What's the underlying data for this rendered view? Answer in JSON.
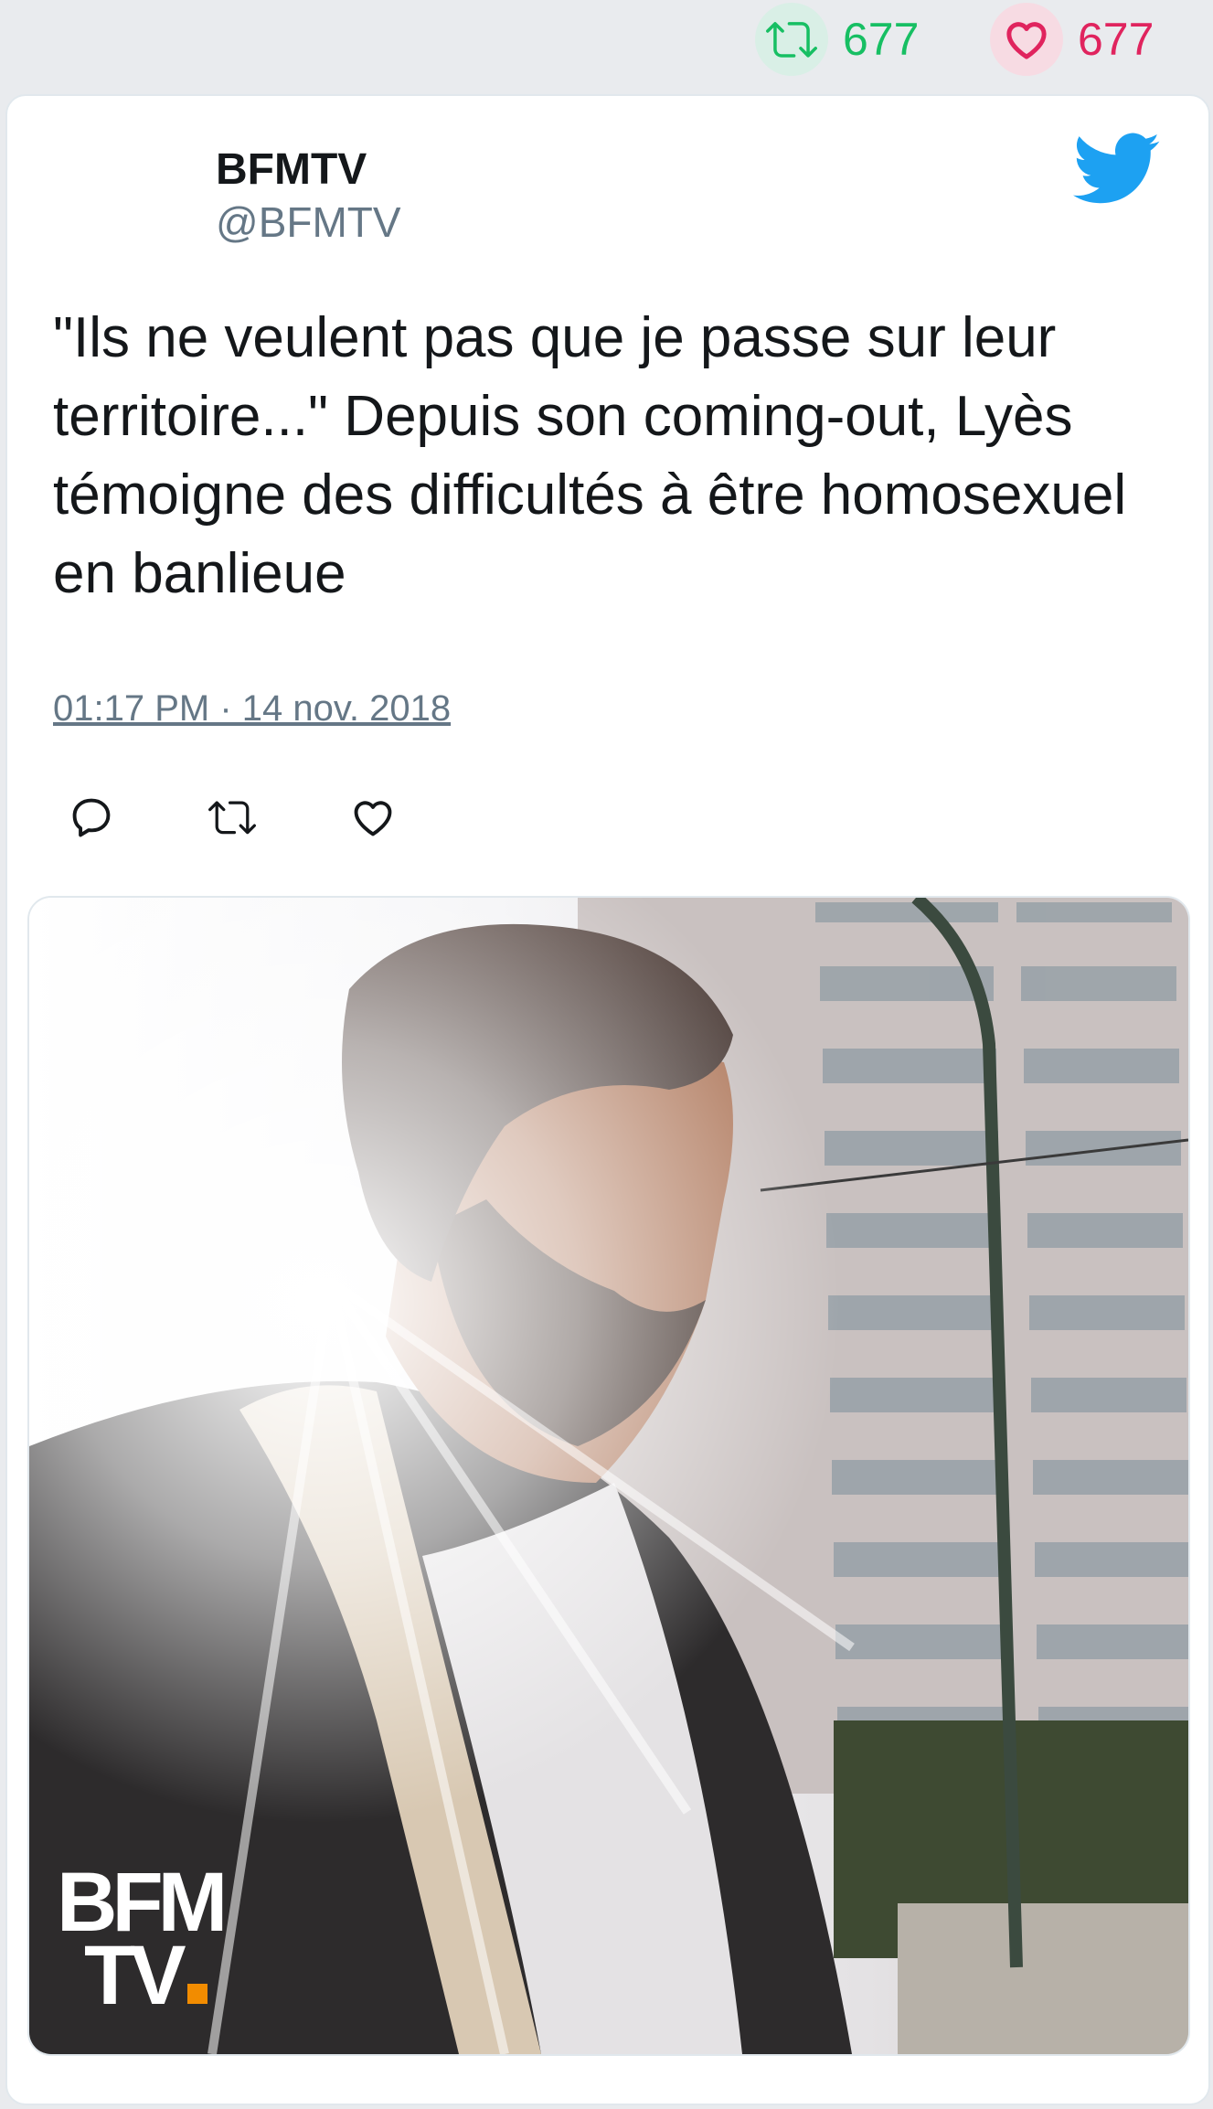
{
  "engagement": {
    "retweet_count": "677",
    "like_count": "677"
  },
  "author": {
    "name": "BFMTV",
    "handle": "@BFMTV"
  },
  "tweet": {
    "text": "\"Ils ne veulent pas que je passe sur leur territoire...\" Depuis son coming-out, Lyès témoigne des difficultés à être homosexuel en banlieue",
    "timestamp": "01:17 PM · 14 nov. 2018"
  },
  "media": {
    "watermark_line1": "BFM",
    "watermark_line2": "TV"
  },
  "icons": {
    "twitter_logo": "twitter-bird-icon",
    "reply": "reply-icon",
    "retweet": "retweet-icon",
    "like": "heart-icon"
  },
  "colors": {
    "twitter_blue": "#1da1f2",
    "retweet_green": "#17bf63",
    "like_pink": "#e0245e",
    "watermark_orange": "#f28c00"
  }
}
